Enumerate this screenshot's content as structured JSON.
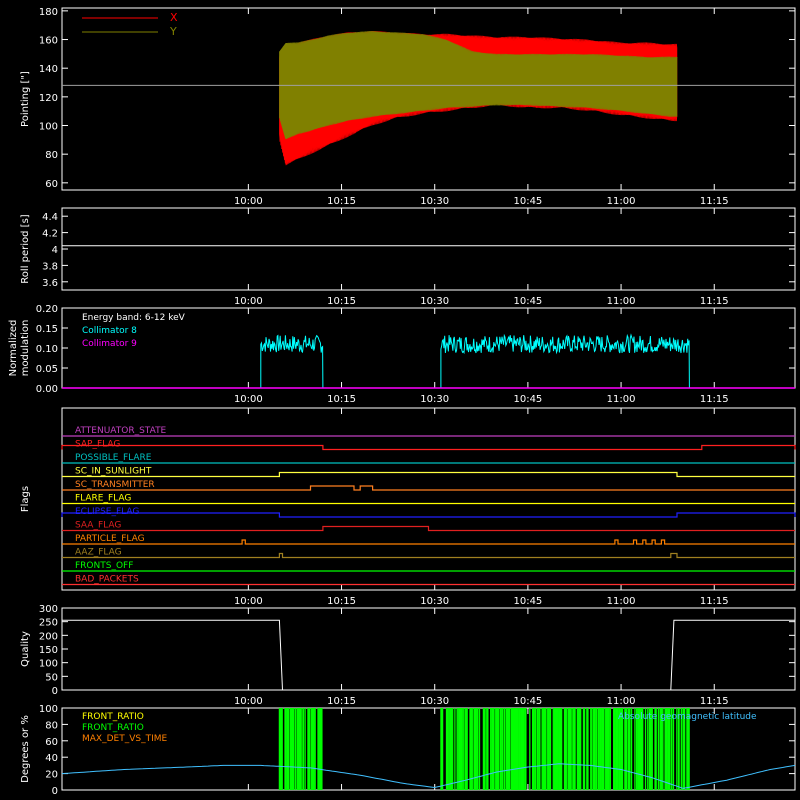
{
  "colors": {
    "background": "#000000",
    "axes": "#ffffff",
    "x_pointing": "#ff0000",
    "y_pointing": "#808000",
    "collimator8": "#00ffff",
    "collimator9": "#ff00ff",
    "front_ratio": "#ffff00",
    "front_ratio_green": "#00ff00",
    "max_det": "#ff8000",
    "latitude": "#40c0ff"
  },
  "chart_data": [
    {
      "type": "area",
      "panel": "pointing",
      "ylabel": "Pointing [\"]",
      "ylim": [
        55,
        182
      ],
      "xlim_min": [
        570,
        688
      ],
      "x_ticks": [
        "10:00",
        "10:15",
        "10:30",
        "10:45",
        "11:00",
        "11:15"
      ],
      "x_tick_min": [
        600,
        615,
        630,
        645,
        660,
        675
      ],
      "y_ticks": [
        60,
        80,
        100,
        120,
        140,
        160,
        180
      ],
      "legend": [
        "X",
        "Y"
      ],
      "legend_placement": "top-left",
      "reference_line": 128,
      "series": [
        {
          "name": "X",
          "x": [
            605,
            606,
            608,
            610,
            613,
            616,
            620,
            624,
            628,
            632,
            636,
            640,
            645,
            650,
            655,
            660,
            664,
            668,
            669
          ],
          "upper": [
            150,
            154,
            158,
            160,
            163,
            165,
            166,
            165,
            164,
            164,
            163,
            162,
            162,
            161,
            160,
            158,
            158,
            157,
            157
          ],
          "lower": [
            90,
            72,
            76,
            80,
            86,
            92,
            100,
            105,
            108,
            110,
            112,
            114,
            112,
            112,
            110,
            107,
            105,
            103,
            103
          ]
        },
        {
          "name": "Y",
          "x": [
            605,
            606,
            608,
            610,
            613,
            616,
            620,
            624,
            628,
            632,
            636,
            640,
            645,
            650,
            655,
            660,
            664,
            668,
            669
          ],
          "upper": [
            152,
            158,
            158,
            160,
            163,
            165,
            166,
            165,
            164,
            160,
            152,
            150,
            150,
            150,
            150,
            149,
            148,
            148,
            148
          ],
          "lower": [
            105,
            90,
            94,
            96,
            100,
            103,
            106,
            108,
            110,
            112,
            113,
            114,
            114,
            113,
            112,
            110,
            108,
            106,
            106
          ]
        }
      ]
    },
    {
      "type": "line",
      "panel": "roll",
      "ylabel": "Roll period [s]",
      "ylim": [
        3.5,
        4.5
      ],
      "y_ticks": [
        3.6,
        3.8,
        4.0,
        4.2,
        4.4
      ],
      "value": 4.04
    },
    {
      "type": "line",
      "panel": "modulation",
      "ylabel": [
        "Normalized",
        "modulation"
      ],
      "ylim": [
        0,
        0.2
      ],
      "y_ticks": [
        0.0,
        0.05,
        0.1,
        0.15,
        0.2
      ],
      "annotation": "Energy band: 6-12 keV",
      "legend": [
        "Collimator 8",
        "Collimator 9"
      ],
      "legend_placement": "top-left",
      "segments_min": [
        [
          602,
          612
        ],
        [
          631,
          671
        ]
      ],
      "mean": 0.11
    },
    {
      "type": "table",
      "panel": "flags",
      "ylabel": "Flags",
      "flags": [
        {
          "name": "ATTENUATOR_STATE",
          "color": "#c040c0",
          "on": []
        },
        {
          "name": "SAP_FLAG",
          "color": "#ff2020",
          "on": [
            [
              570,
              612
            ],
            [
              673,
              688
            ]
          ]
        },
        {
          "name": "POSSIBLE_FLARE",
          "color": "#00c0c0",
          "on": []
        },
        {
          "name": "SC_IN_SUNLIGHT",
          "color": "#ffff40",
          "on": [
            [
              605,
              669
            ]
          ]
        },
        {
          "name": "SC_TRANSMITTER",
          "color": "#ff8020",
          "on": [
            [
              610,
              617
            ],
            [
              618,
              620
            ]
          ]
        },
        {
          "name": "FLARE_FLAG",
          "color": "#ffff00",
          "on": []
        },
        {
          "name": "ECLIPSE_FLAG",
          "color": "#2020ff",
          "on": [
            [
              570,
              605
            ],
            [
              669,
              688
            ]
          ]
        },
        {
          "name": "SAA_FLAG",
          "color": "#e02020",
          "on": [
            [
              612,
              629
            ]
          ]
        },
        {
          "name": "PARTICLE_FLAG",
          "color": "#ff8000",
          "on": [
            [
              599,
              599.5
            ],
            [
              659,
              659.5
            ],
            [
              662,
              662.5
            ],
            [
              663.5,
              664
            ],
            [
              665,
              665.5
            ],
            [
              666.5,
              667
            ]
          ]
        },
        {
          "name": "AAZ_FLAG",
          "color": "#a08020",
          "on": [
            [
              605,
              605.5
            ],
            [
              668,
              669
            ]
          ]
        },
        {
          "name": "FRONTS_OFF",
          "color": "#00ff00",
          "on": []
        },
        {
          "name": "BAD_PACKETS",
          "color": "#ff3030",
          "on": []
        }
      ]
    },
    {
      "type": "line",
      "panel": "quality",
      "ylabel": "Quality",
      "ylim": [
        0,
        300
      ],
      "y_ticks": [
        0,
        50,
        100,
        150,
        200,
        250,
        300
      ],
      "x_min": [
        570,
        605,
        605.5,
        668,
        668.5,
        688
      ],
      "values": [
        255,
        255,
        0,
        0,
        255,
        255
      ]
    },
    {
      "type": "bar",
      "panel": "front_ratio",
      "ylabel": "Degrees or %",
      "ylim": [
        0,
        100
      ],
      "y_ticks": [
        0,
        20,
        40,
        60,
        80,
        100
      ],
      "legend": [
        "FRONT_RATIO",
        "FRONT_RATIO",
        "MAX_DET_VS_TIME"
      ],
      "annotation": "Absolute geomagnetic latitude",
      "segments_min": [
        [
          605,
          612
        ],
        [
          631,
          671
        ]
      ],
      "latitude_x_min": [
        570,
        580,
        590,
        596,
        602,
        610,
        618,
        625,
        630,
        635,
        640,
        645,
        650,
        655,
        660,
        665,
        670,
        677,
        684,
        688
      ],
      "latitude_values": [
        20,
        25,
        28,
        30,
        30,
        27,
        18,
        8,
        3,
        12,
        22,
        28,
        32,
        30,
        25,
        15,
        2,
        12,
        25,
        30
      ]
    }
  ]
}
